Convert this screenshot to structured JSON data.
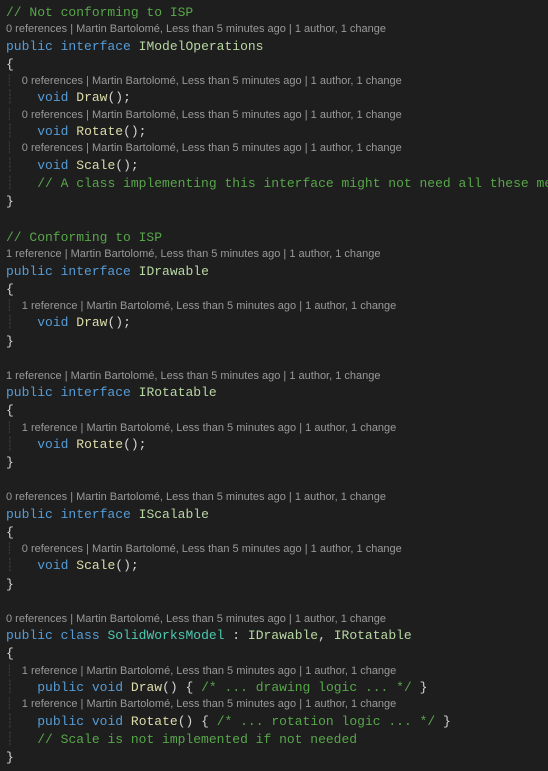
{
  "codelens": {
    "ref0": "0 references",
    "ref1": "1 reference",
    "sep": " | ",
    "author": "Martin Bartolomé, Less than 5 minutes ago",
    "tail": "1 author, 1 change"
  },
  "code": {
    "comment_not_isp": "// Not conforming to ISP",
    "public": "public",
    "interface": "interface",
    "class_kw": "class",
    "void": "void",
    "IModelOperations": "IModelOperations",
    "IDrawable": "IDrawable",
    "IRotatable": "IRotatable",
    "IScalable": "IScalable",
    "SolidWorksModel": "SolidWorksModel",
    "Draw": "Draw",
    "Rotate": "Rotate",
    "Scale": "Scale",
    "open_brace": "{",
    "close_brace": "}",
    "paren_semi": "();",
    "paren_open": "()",
    "body_open": " { ",
    "body_close": " }",
    "colon_sep": " : ",
    "comma_sp": ", ",
    "comment_isp": "// Conforming to ISP",
    "comment_all_methods": "// A class implementing this interface might not need all these methods",
    "comment_draw_logic": "/* ... drawing logic ... */",
    "comment_rot_logic": "/* ... rotation logic ... */",
    "comment_scale_not": "// Scale is not implemented if not needed",
    "indent": "    ",
    "guide_indent": "┊   "
  }
}
